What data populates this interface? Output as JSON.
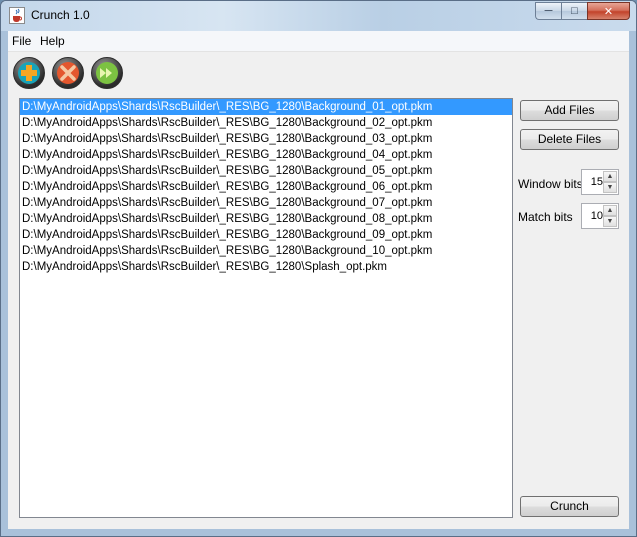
{
  "window": {
    "title": "Crunch 1.0",
    "app_icon": "java-cup-icon"
  },
  "window_controls": {
    "minimize": "─",
    "maximize": "□",
    "close": "✕"
  },
  "menu": {
    "items": [
      {
        "label": "File"
      },
      {
        "label": "Help"
      }
    ]
  },
  "toolbar": {
    "buttons": [
      {
        "icon": "plus-icon",
        "color": "#f5a623"
      },
      {
        "icon": "tools-icon",
        "color": "#e4572e"
      },
      {
        "icon": "fast-forward-icon",
        "color": "#7cc242"
      }
    ]
  },
  "files": [
    "D:\\MyAndroidApps\\Shards\\RscBuilder\\_RES\\BG_1280\\Background_01_opt.pkm",
    "D:\\MyAndroidApps\\Shards\\RscBuilder\\_RES\\BG_1280\\Background_02_opt.pkm",
    "D:\\MyAndroidApps\\Shards\\RscBuilder\\_RES\\BG_1280\\Background_03_opt.pkm",
    "D:\\MyAndroidApps\\Shards\\RscBuilder\\_RES\\BG_1280\\Background_04_opt.pkm",
    "D:\\MyAndroidApps\\Shards\\RscBuilder\\_RES\\BG_1280\\Background_05_opt.pkm",
    "D:\\MyAndroidApps\\Shards\\RscBuilder\\_RES\\BG_1280\\Background_06_opt.pkm",
    "D:\\MyAndroidApps\\Shards\\RscBuilder\\_RES\\BG_1280\\Background_07_opt.pkm",
    "D:\\MyAndroidApps\\Shards\\RscBuilder\\_RES\\BG_1280\\Background_08_opt.pkm",
    "D:\\MyAndroidApps\\Shards\\RscBuilder\\_RES\\BG_1280\\Background_09_opt.pkm",
    "D:\\MyAndroidApps\\Shards\\RscBuilder\\_RES\\BG_1280\\Background_10_opt.pkm",
    "D:\\MyAndroidApps\\Shards\\RscBuilder\\_RES\\BG_1280\\Splash_opt.pkm"
  ],
  "selected_index": 0,
  "buttons": {
    "add_files": "Add Files",
    "delete_files": "Delete Files",
    "crunch": "Crunch"
  },
  "settings": {
    "window_bits": {
      "label": "Window bits",
      "value": "15"
    },
    "match_bits": {
      "label": "Match bits",
      "value": "10"
    }
  },
  "colors": {
    "selection": "#3399ff"
  }
}
